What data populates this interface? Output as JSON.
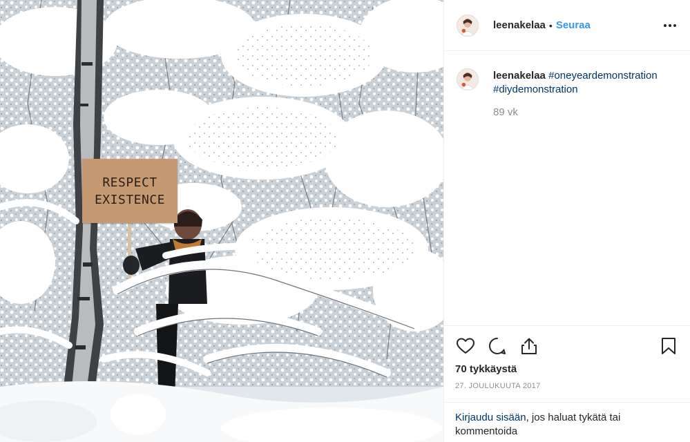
{
  "photo": {
    "sign_line1": "RESPECT",
    "sign_line2": "EXISTENCE"
  },
  "header": {
    "username": "leenakelaa",
    "separator": "•",
    "follow_label": "Seuraa",
    "more_icon": "more-horizontal-icon"
  },
  "caption": {
    "username": "leenakelaa",
    "hashtag1": "#oneyeardemonstration",
    "hashtag2": "#diydemonstration",
    "age": "89 vk"
  },
  "actions": {
    "like_icon": "heart-icon",
    "comment_icon": "comment-icon",
    "share_icon": "share-icon",
    "save_icon": "bookmark-icon",
    "likes": "70 tykkäystä",
    "date": "27. JOULUKUUTA 2017"
  },
  "login": {
    "link": "Kirjaudu sisään",
    "text": ", jos haluat tykätä tai kommentoida"
  },
  "colors": {
    "link_blue": "#3897f0",
    "hashtag_blue": "#003569",
    "muted_gray": "#8e8e8e",
    "border": "#efefef",
    "sign_cardboard": "#c59a72"
  }
}
